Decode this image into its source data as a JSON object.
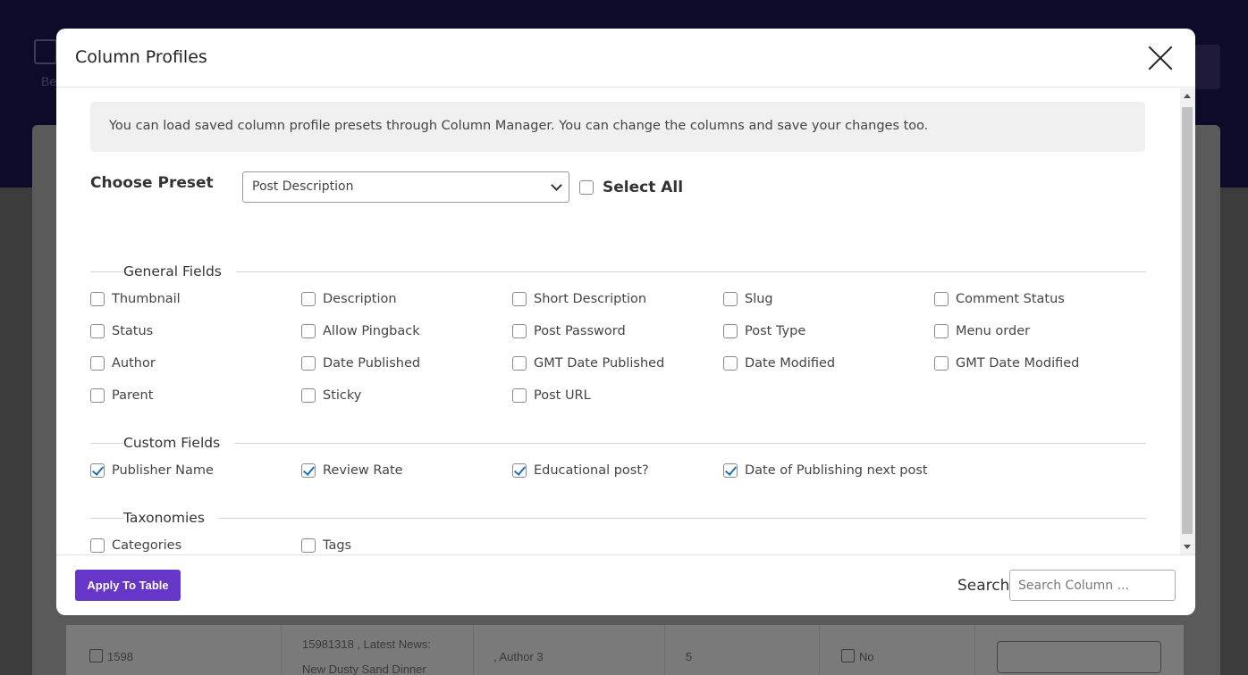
{
  "background": {
    "logo_text": "Be",
    "row": {
      "id": "1598",
      "title_line1": "15981318 , Latest News:",
      "title_line2": "New Dusty Sand Dinner",
      "author": ", Author 3",
      "count": "5",
      "flag": "No"
    }
  },
  "modal": {
    "title": "Column Profiles",
    "info": "You can load saved column profile presets through Column Manager. You can change the columns and save your changes too.",
    "preset_label": "Choose Preset",
    "preset_value": "Post Description",
    "select_all_label": "Select All",
    "sections": {
      "general": {
        "title": "General Fields",
        "fields": [
          {
            "label": "Thumbnail",
            "checked": false
          },
          {
            "label": "Description",
            "checked": false
          },
          {
            "label": "Short Description",
            "checked": false
          },
          {
            "label": "Slug",
            "checked": false
          },
          {
            "label": "Comment Status",
            "checked": false
          },
          {
            "label": "Status",
            "checked": false
          },
          {
            "label": "Allow Pingback",
            "checked": false
          },
          {
            "label": "Post Password",
            "checked": false
          },
          {
            "label": "Post Type",
            "checked": false
          },
          {
            "label": "Menu order",
            "checked": false
          },
          {
            "label": "Author",
            "checked": false
          },
          {
            "label": "Date Published",
            "checked": false
          },
          {
            "label": "GMT Date Published",
            "checked": false
          },
          {
            "label": "Date Modified",
            "checked": false
          },
          {
            "label": "GMT Date Modified",
            "checked": false
          },
          {
            "label": "Parent",
            "checked": false
          },
          {
            "label": "Sticky",
            "checked": false
          },
          {
            "label": "Post URL",
            "checked": false
          }
        ]
      },
      "custom": {
        "title": "Custom Fields",
        "fields": [
          {
            "label": "Publisher Name",
            "checked": true
          },
          {
            "label": "Review Rate",
            "checked": true
          },
          {
            "label": "Educational post?",
            "checked": true
          },
          {
            "label": "Date of Publishing next post",
            "checked": true
          }
        ]
      },
      "taxonomies": {
        "title": "Taxonomies",
        "fields": [
          {
            "label": "Categories",
            "checked": false
          },
          {
            "label": "Tags",
            "checked": false
          }
        ]
      }
    },
    "footer": {
      "apply_label": "Apply To Table",
      "search_label": "Search",
      "search_placeholder": "Search Column ..."
    }
  }
}
